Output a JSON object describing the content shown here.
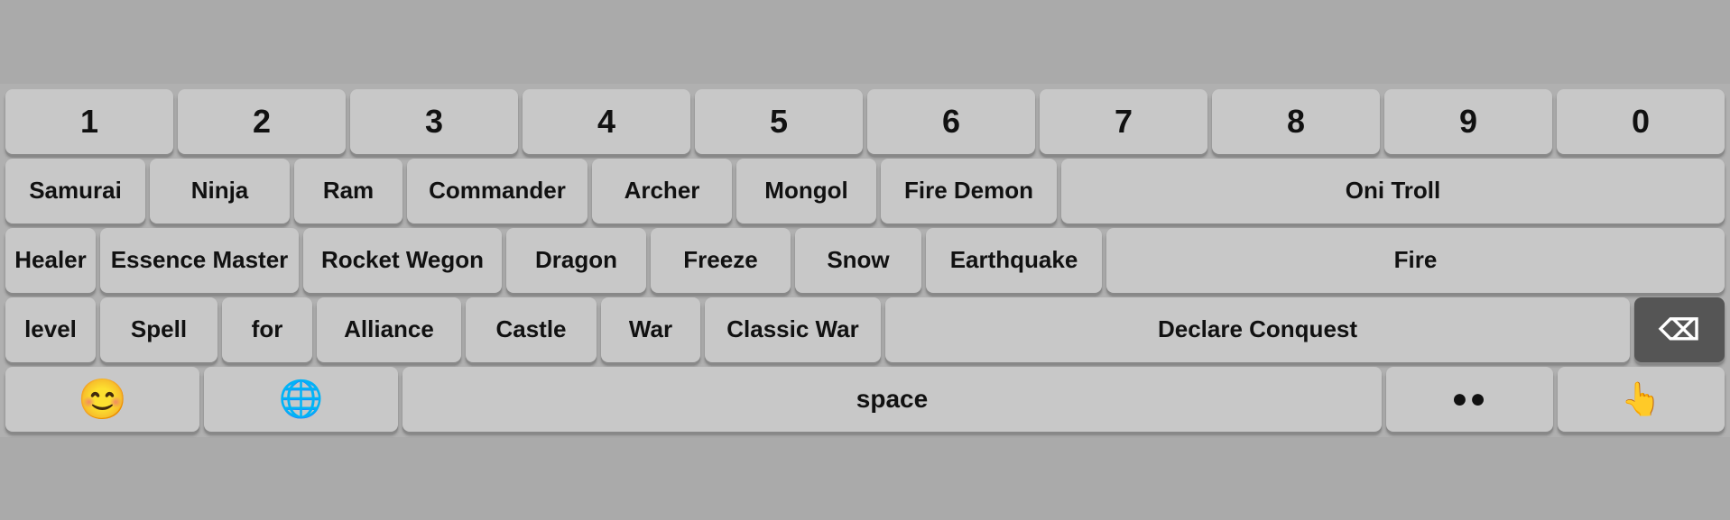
{
  "rows": {
    "numbers": [
      "1",
      "2",
      "3",
      "4",
      "5",
      "6",
      "7",
      "8",
      "9",
      "0"
    ],
    "row2": [
      "Samurai",
      "Ninja",
      "Ram",
      "Commander",
      "Archer",
      "Mongol",
      "Fire Demon",
      "Oni Troll"
    ],
    "row3": [
      "Healer",
      "Essence Master",
      "Rocket Wegon",
      "Dragon",
      "Freeze",
      "Snow",
      "Earthquake",
      "Fire"
    ],
    "row4": [
      "level",
      "Spell",
      "for",
      "Alliance",
      "Castle",
      "War",
      "Classic War",
      "Declare Conquest"
    ],
    "bottom": {
      "emoji_label": "😊",
      "globe_label": "🌐",
      "space_label": "space",
      "dots_label": "⬤⬤",
      "enter_label": "⏎"
    }
  },
  "backspace_label": "✕",
  "colors": {
    "key_bg": "#c8c8c8",
    "keyboard_bg": "#b0b0b0",
    "dark_key_bg": "#555555"
  }
}
